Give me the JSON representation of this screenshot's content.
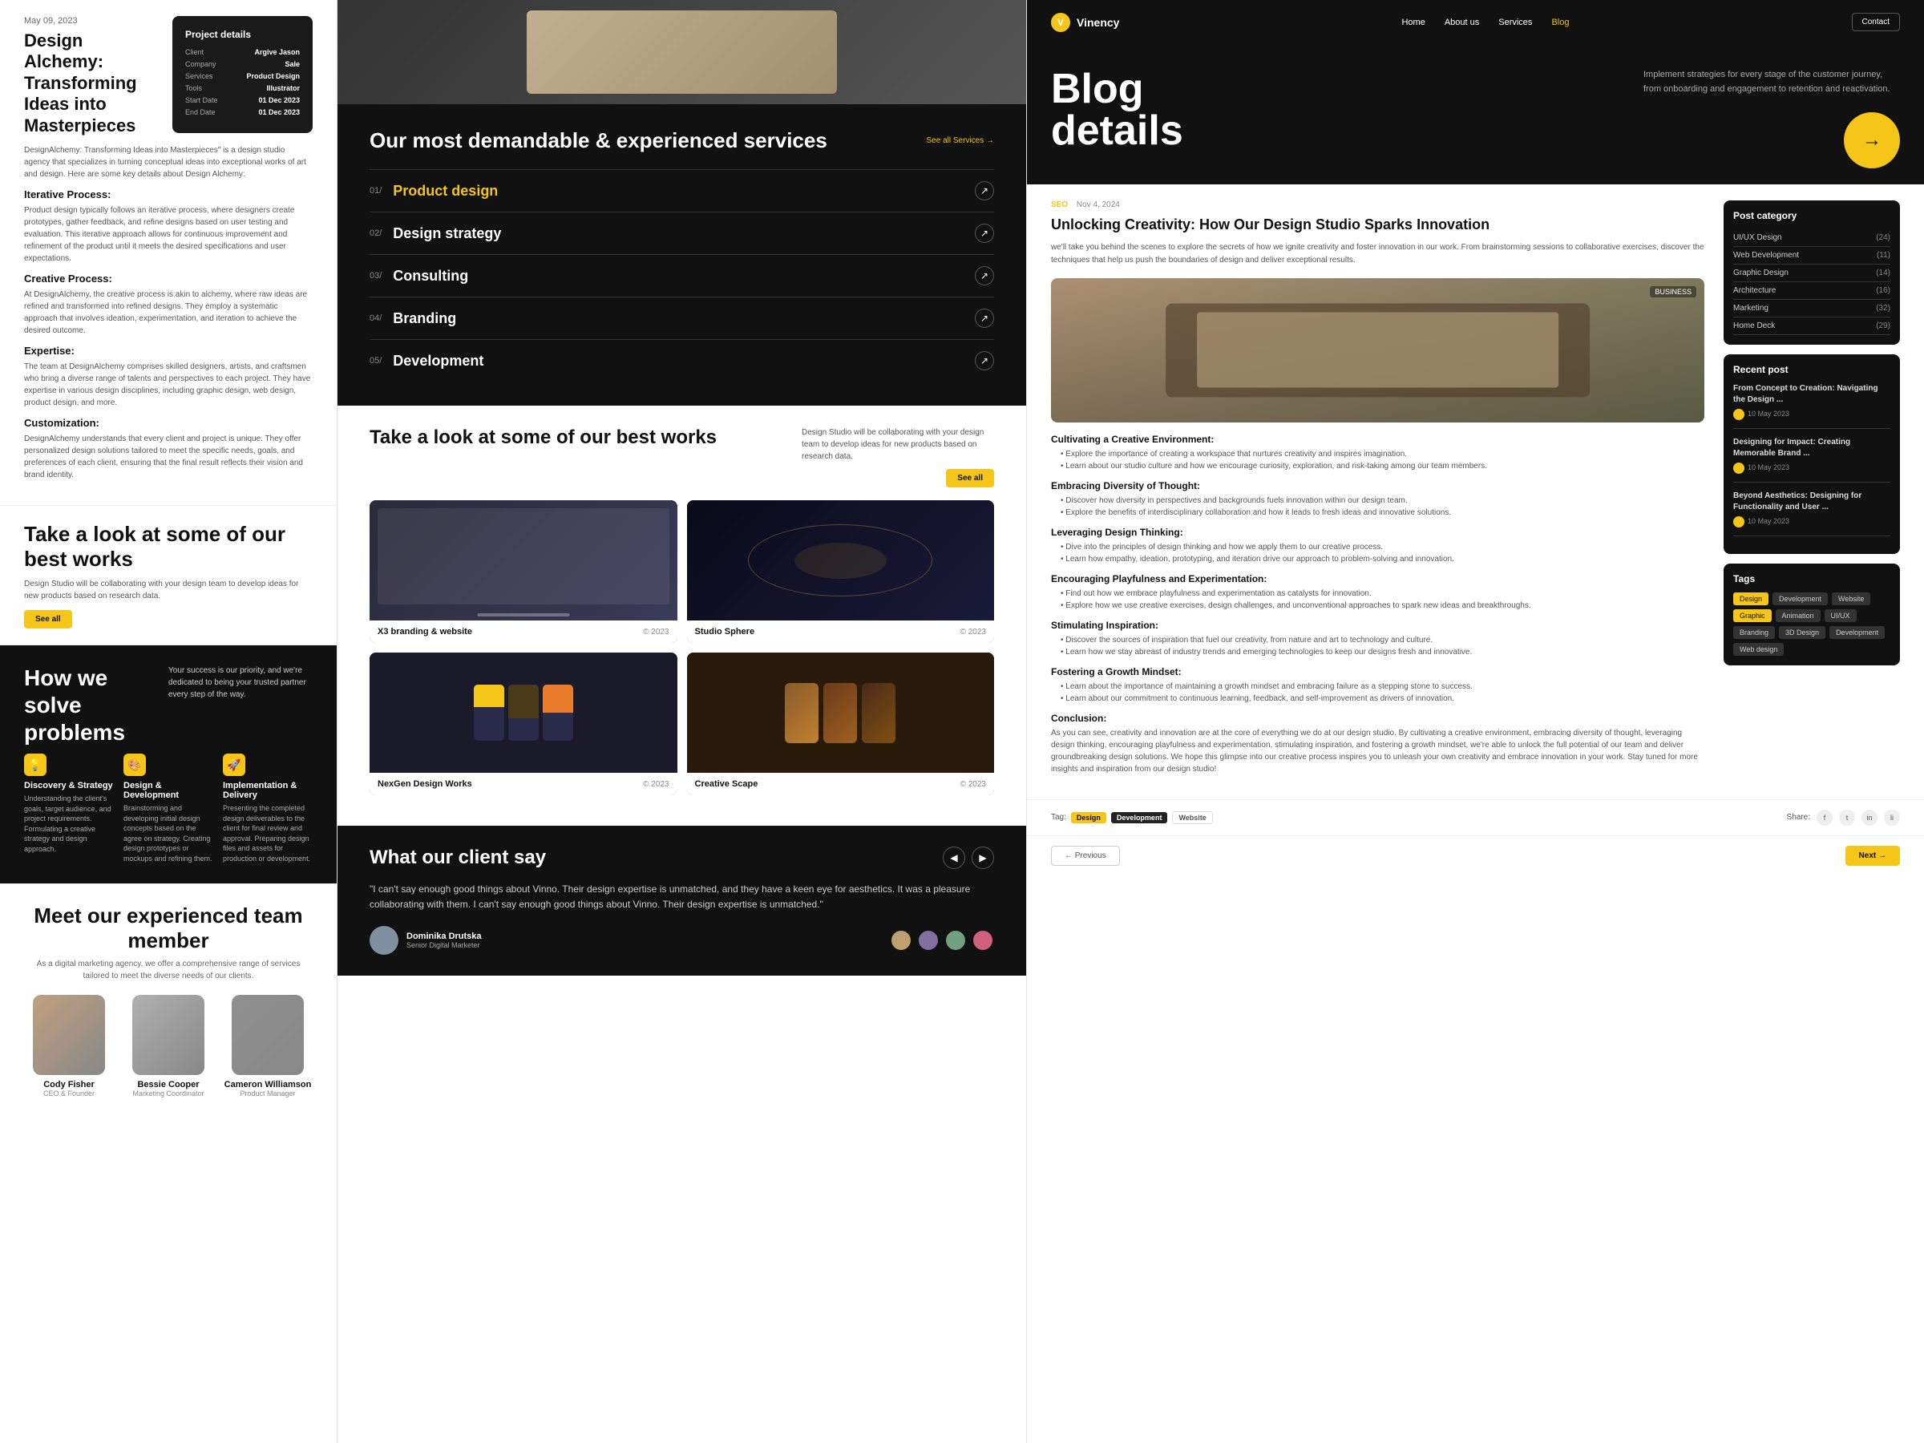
{
  "left": {
    "blog_date": "May 09, 2023",
    "blog_title": "Design Alchemy: Transforming Ideas into Masterpieces",
    "blog_desc": "DesignAlchemy: Transforming Ideas into Masterpieces\" is a design studio agency that specializes in turning conceptual ideas into exceptional works of art and design. Here are some key details about Design Alchemy:",
    "sections": [
      {
        "title": "Iterative Process:",
        "text": "Product design typically follows an iterative process, where designers create prototypes, gather feedback, and refine designs based on user testing and evaluation. This iterative approach allows for continuous improvement and refinement of the product until it meets the desired specifications and user expectations."
      },
      {
        "title": "Creative Process:",
        "text": "At DesignAlchemy, the creative process is akin to alchemy, where raw ideas are refined and transformed into refined designs. They employ a systematic approach that involves ideation, experimentation, and iteration to achieve the desired outcome."
      },
      {
        "title": "Expertise:",
        "text": "The team at DesignAlchemy comprises skilled designers, artists, and craftsmen who bring a diverse range of talents and perspectives to each project. They have expertise in various design disciplines, including graphic design, web design, product design, and more."
      },
      {
        "title": "Customization:",
        "text": "DesignAlchemy understands that every client and project is unique. They offer personalized design solutions tailored to meet the specific needs, goals, and preferences of each client, ensuring that the final result reflects their vision and brand identity."
      }
    ],
    "project_details": {
      "title": "Project details",
      "rows": [
        {
          "label": "Client",
          "value": "Argive Jason"
        },
        {
          "label": "Company",
          "value": "Sale"
        },
        {
          "label": "Services",
          "value": "Product Design"
        },
        {
          "label": "Tools",
          "value": "Illustrator"
        },
        {
          "label": "Start Date",
          "value": "01 Dec 2023"
        },
        {
          "label": "End Date",
          "value": "01 Dec 2023"
        }
      ]
    },
    "best_works_title": "Take a look at some of our best works",
    "best_works_desc": "Design Studio will be collaborating with your design team to develop ideas for new products based on research data.",
    "see_all_label": "See all",
    "how_title": "How we solve problems",
    "how_subtitle": "Your success is our priority, and we're dedicated to being your trusted partner every step of the way.",
    "how_cards": [
      {
        "icon": "💡",
        "title": "Discovery & Strategy",
        "text": "Understanding the client's goals, target audience, and project requirements. Formulating a creative strategy and design approach."
      },
      {
        "icon": "🎨",
        "title": "Design & Development",
        "text": "Brainstorming and developing initial design concepts based on the agree on strategy. Creating design prototypes or mockups and refining them."
      },
      {
        "icon": "🚀",
        "title": "Implementation & Delivery",
        "text": "Presenting the completed design deliverables to the client for final review and approval. Preparing design files and assets for production or development."
      }
    ],
    "team_title": "Meet our experienced team member",
    "team_subtitle": "As a digital marketing agency, we offer a comprehensive range of services tailored to meet the diverse needs of our clients.",
    "team_members": [
      {
        "name": "Cody Fisher",
        "role": "CEO & Founder"
      },
      {
        "name": "Bessie Cooper",
        "role": "Marketing Coordinator"
      },
      {
        "name": "Cameron Williamson",
        "role": "Product Manager"
      }
    ]
  },
  "mid": {
    "services_title": "Our most demandable & experienced services",
    "see_all_services": "See all Services →",
    "services": [
      {
        "num": "01/",
        "name": "Product design",
        "active": true
      },
      {
        "num": "02/",
        "name": "Design strategy",
        "active": false
      },
      {
        "num": "03/",
        "name": "Consulting",
        "active": false
      },
      {
        "num": "04/",
        "name": "Branding",
        "active": false
      },
      {
        "num": "05/",
        "name": "Development",
        "active": false
      }
    ],
    "works_title": "Take a look at some of our best works",
    "works_desc": "Design Studio will be collaborating with your design team to develop ideas for new products based on research data.",
    "see_all_label": "See all",
    "works": [
      {
        "name": "X3 branding & website",
        "year": "© 2023"
      },
      {
        "name": "Studio Sphere",
        "year": "© 2023"
      },
      {
        "name": "NexGen Design Works",
        "year": "© 2023"
      },
      {
        "name": "Creative Scape",
        "year": "© 2023"
      }
    ],
    "client_title": "What our client say",
    "client_quote": "\"I can't say enough good things about Vinno. Their design expertise is unmatched, and they have a keen eye for aesthetics. It was a pleasure collaborating with them. I can't say enough good things about Vinno. Their design expertise is unmatched.\"",
    "client_name": "Dominika Drutska",
    "client_role": "Senior Digital Marketer"
  },
  "right": {
    "nav": {
      "logo": "Vinency",
      "links": [
        "Home",
        "About us",
        "Services",
        "Blog"
      ],
      "active_link": "Blog",
      "contact_label": "Contact"
    },
    "hero": {
      "title_line1": "Blog",
      "title_line2": "details",
      "desc": "Implement strategies for every stage of the customer journey, from onboarding and engagement to retention and reactivation."
    },
    "article": {
      "tag": "SEO",
      "date": "Nov 4, 2024",
      "title": "Unlocking Creativity: How Our Design Studio Sparks Innovation",
      "intro": "we'll take you behind the scenes to explore the secrets of how we ignite creativity and foster innovation in our work. From brainstorming sessions to collaborative exercises, discover the techniques that help us push the boundaries of design and deliver exceptional results.",
      "sections": [
        {
          "title": "Cultivating a Creative Environment:",
          "bullets": [
            "Explore the importance of creating a workspace that nurtures creativity and inspires imagination.",
            "Learn about our studio culture and how we encourage curiosity, exploration, and risk-taking among our team members."
          ]
        },
        {
          "title": "Embracing Diversity of Thought:",
          "bullets": [
            "Discover how diversity in perspectives and backgrounds fuels innovation within our design team.",
            "Explore the benefits of interdisciplinary collaboration and how it leads to fresh ideas and innovative solutions."
          ]
        },
        {
          "title": "Leveraging Design Thinking:",
          "bullets": [
            "Dive into the principles of design thinking and how we apply them to our creative process.",
            "Learn how empathy, ideation, prototyping, and iteration drive our approach to problem-solving and innovation."
          ]
        },
        {
          "title": "Encouraging Playfulness and Experimentation:",
          "bullets": [
            "Find out how we embrace playfulness and experimentation as catalysts for innovation.",
            "Explore how we use creative exercises, design challenges, and unconventional approaches to spark new ideas and breakthroughs."
          ]
        },
        {
          "title": "Stimulating Inspiration:",
          "bullets": [
            "Discover the sources of inspiration that fuel our creativity, from nature and art to technology and culture.",
            "Learn how we stay abreast of industry trends and emerging technologies to keep our designs fresh and innovative."
          ]
        },
        {
          "title": "Fostering a Growth Mindset:",
          "bullets": [
            "Learn about the importance of maintaining a growth mindset and embracing failure as a stepping stone to success.",
            "Learn about our commitment to continuous learning, feedback, and self-improvement as drivers of innovation."
          ]
        },
        {
          "title": "Conclusion:",
          "text": "As you can see, creativity and innovation are at the core of everything we do at our design studio. By cultivating a creative environment, embracing diversity of thought, leveraging design thinking, encouraging playfulness and experimentation, stimulating inspiration, and fostering a growth mindset, we're able to unlock the full potential of our team and deliver groundbreaking design solutions. We hope this glimpse into our creative process inspires you to unleash your own creativity and embrace innovation in your work. Stay tuned for more insights and inspiration from our design studio!"
        }
      ]
    },
    "sidebar": {
      "categories_title": "Post category",
      "categories": [
        {
          "name": "UI/UX Design",
          "count": 24
        },
        {
          "name": "Web Development",
          "count": 11
        },
        {
          "name": "Graphic Design",
          "count": 14
        },
        {
          "name": "Architecture",
          "count": 16
        },
        {
          "name": "Marketing",
          "count": 32
        },
        {
          "name": "Home Deck",
          "count": 29
        }
      ],
      "recent_title": "Recent post",
      "recent_posts": [
        {
          "title": "From Concept to Creation: Navigating the Design ...",
          "date": "10 May 2023"
        },
        {
          "title": "Designing for Impact: Creating Memorable Brand ...",
          "date": "10 May 2023"
        },
        {
          "title": "Beyond Aesthetics: Designing for Functionality and User ...",
          "date": "10 May 2023"
        }
      ],
      "tags_title": "Tags",
      "tags": [
        "Design",
        "Development",
        "Website",
        "Graphic",
        "Animation",
        "UI/UX",
        "Branding",
        "3D Design",
        "Development",
        "Web design"
      ]
    },
    "footer": {
      "tag_label": "Tag:",
      "tags": [
        "Design",
        "Development",
        "Website"
      ],
      "share_label": "Share:",
      "prev_label": "← Previous",
      "next_label": "Next →"
    }
  }
}
